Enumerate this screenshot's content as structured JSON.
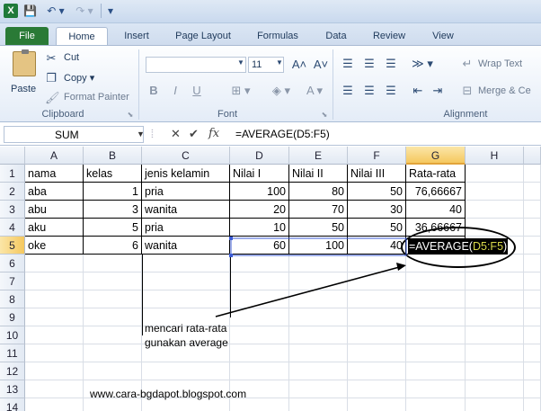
{
  "quick_access": {
    "logo": "X",
    "save": "💾",
    "undo": "↶ ▾",
    "redo": "↷ ▾",
    "more": "▾"
  },
  "tabs": [
    "File",
    "Home",
    "Insert",
    "Page Layout",
    "Formulas",
    "Data",
    "Review",
    "View"
  ],
  "ribbon": {
    "clipboard": {
      "paste": "Paste",
      "cut": "Cut",
      "copy": "Copy ▾",
      "format_painter": "Format Painter",
      "group": "Clipboard"
    },
    "font": {
      "size": "11",
      "bold": "B",
      "italic": "I",
      "underline": "U",
      "group": "Font",
      "grow": "A˄",
      "shrink": "A˅",
      "border": "⊞ ▾",
      "fill": "◈ ▾",
      "color": "A ▾"
    },
    "alignment": {
      "wrap_text": "Wrap Text",
      "merge": "Merge & Ce",
      "group": "Alignment",
      "orient": "≫ ▾"
    }
  },
  "formula_bar": {
    "name_box": "SUM",
    "formula": "=AVERAGE(D5:F5)",
    "cancel": "✕",
    "enter": "✔",
    "fx": "fx"
  },
  "sheet": {
    "columns": [
      "A",
      "B",
      "C",
      "D",
      "E",
      "F",
      "G",
      "H"
    ],
    "rows": [
      "1",
      "2",
      "3",
      "4",
      "5",
      "6",
      "7",
      "8",
      "9",
      "10",
      "11",
      "12",
      "13",
      "14"
    ],
    "header_row": [
      "nama",
      "kelas",
      "jenis kelamin",
      "Nilai I",
      "Nilai II",
      "Nilai III",
      "Rata-rata"
    ],
    "data_rows": [
      {
        "nama": "aba",
        "kelas": "1",
        "jk": "pria",
        "n1": "100",
        "n2": "80",
        "n3": "50",
        "avg": "76,66667"
      },
      {
        "nama": "abu",
        "kelas": "3",
        "jk": "wanita",
        "n1": "20",
        "n2": "70",
        "n3": "30",
        "avg": "40"
      },
      {
        "nama": "aku",
        "kelas": "5",
        "jk": "pria",
        "n1": "10",
        "n2": "50",
        "n3": "50",
        "avg": "36,66667"
      },
      {
        "nama": "oke",
        "kelas": "6",
        "jk": "wanita",
        "n1": "60",
        "n2": "100",
        "n3": "40",
        "avg": ""
      }
    ],
    "editing_formula_prefix": "=AVERAGE(",
    "editing_formula_ref": "D5:F5",
    "editing_formula_suffix": ")"
  },
  "annotation": {
    "line1": "mencari rata-rata",
    "line2": "gunakan average"
  },
  "watermark": "www.cara-bgdapot.blogspot.com"
}
